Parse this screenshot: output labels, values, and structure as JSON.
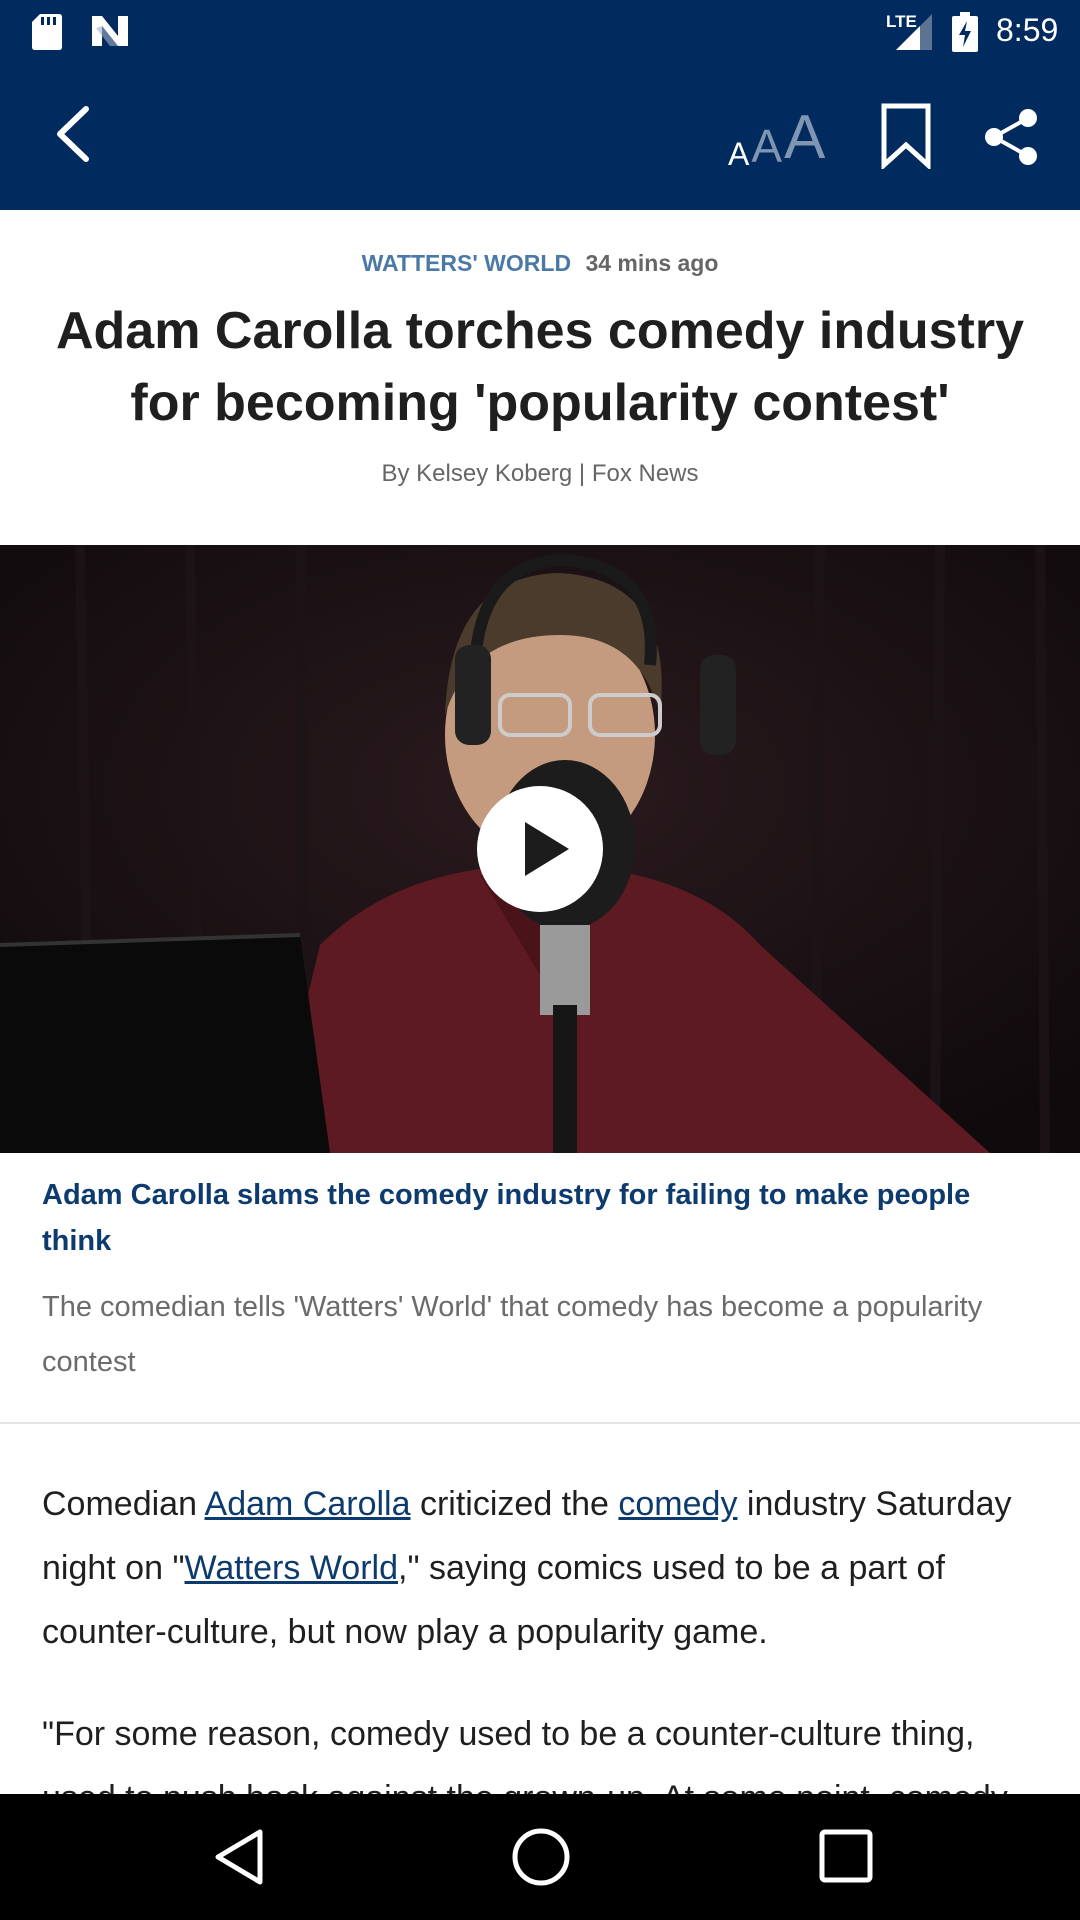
{
  "status_bar": {
    "network": "LTE",
    "time": "8:59",
    "icons": [
      "sd-card-icon",
      "n-notification-icon",
      "signal-icon",
      "battery-charging-icon"
    ]
  },
  "toolbar": {
    "text_size_small": "A",
    "text_size_medium": "A",
    "text_size_large": "A",
    "icons": [
      "back-arrow-icon",
      "text-size-icon",
      "bookmark-icon",
      "share-icon"
    ],
    "colors": {
      "background": "#012b5f",
      "inactive_text_size": "#7f95b1"
    }
  },
  "article": {
    "section": "WATTERS' WORLD",
    "time_ago": "34 mins ago",
    "headline": "Adam Carolla torches comedy industry for becoming 'popularity contest'",
    "byline": "By Kelsey Koberg | Fox News",
    "video": {
      "caption_title": "Adam Carolla slams the comedy industry for failing to make people think",
      "caption_description": "The comedian tells 'Watters' World' that comedy has become a popularity contest"
    },
    "body": {
      "p1_prefix": "Comedian ",
      "p1_link1": "Adam Carolla",
      "p1_mid1": " criticized the ",
      "p1_link2": "comedy",
      "p1_mid2": " industry Saturday night on \"",
      "p1_link3": "Watters World",
      "p1_suffix": ",\" saying comics used to be a part of counter-culture, but now play a popularity game.",
      "p2": "\"For some reason, comedy used to be a counter-culture thing, used to push back against the grown-up. At some point, comedy"
    }
  },
  "nav_bar": {
    "icons": [
      "nav-back-icon",
      "nav-home-icon",
      "nav-recents-icon"
    ]
  }
}
